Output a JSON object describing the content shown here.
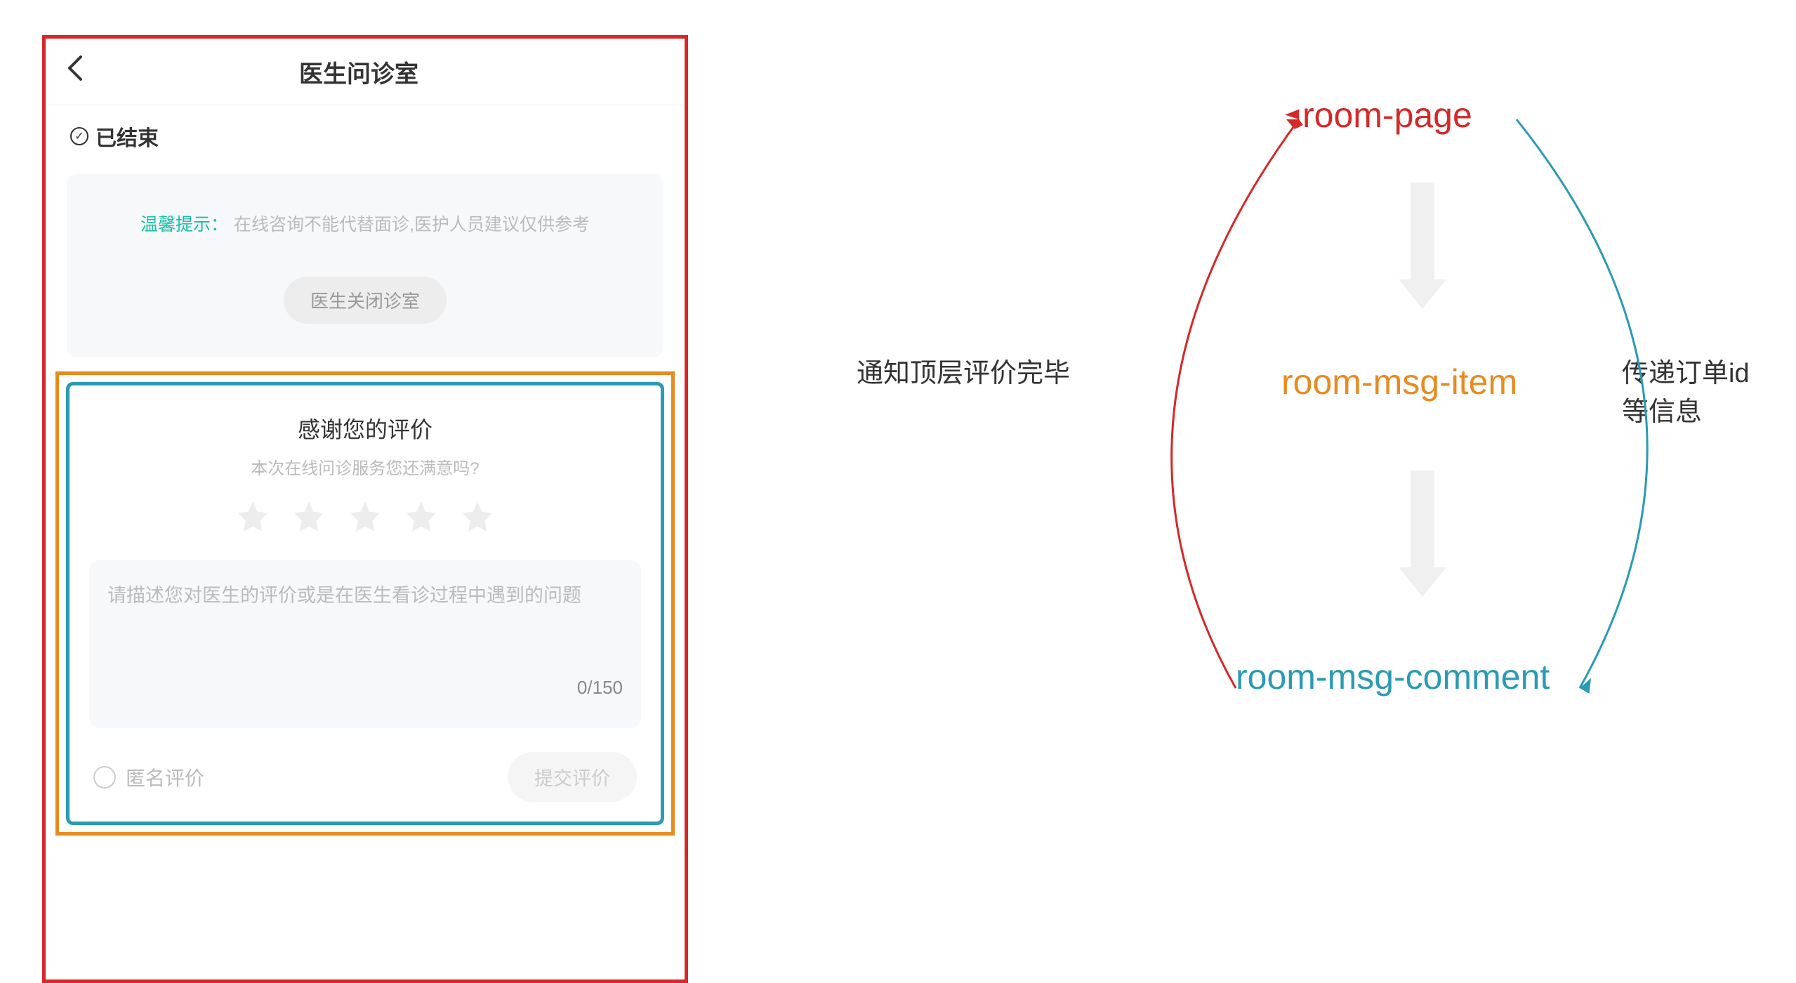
{
  "phone": {
    "header_title": "医生问诊室",
    "status_text": "已结束",
    "tip_label": "温馨提示：",
    "tip_text": "在线咨询不能代替面诊,医护人员建议仅供参考",
    "close_pill": "医生关闭诊室",
    "comment": {
      "title": "感谢您的评价",
      "subtitle": "本次在线问诊服务您还满意吗?",
      "placeholder": "请描述您对医生的评价或是在医生看诊过程中遇到的问题",
      "char_count": "0/150",
      "anonymous_label": "匿名评价",
      "submit_label": "提交评价"
    }
  },
  "diagram": {
    "node_room_page": "room-page",
    "node_room_msg_item": "room-msg-item",
    "node_room_msg_comment": "room-msg-comment",
    "annotation_left": "通知顶层评价完毕",
    "annotation_right": "传递订单id等信息",
    "colors": {
      "room_page": "#d62828",
      "room_msg_item": "#e88b1f",
      "room_msg_comment": "#2a9bb3"
    }
  }
}
